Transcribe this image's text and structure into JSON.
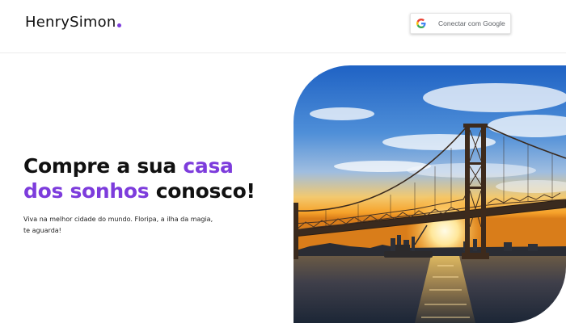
{
  "header": {
    "logo_text": "HenrySimon",
    "google_button_label": "Conectar com Google"
  },
  "hero": {
    "title_part1": "Compre a sua ",
    "title_accent1": "casa",
    "title_accent2": "dos sonhos",
    "title_part2": " conosco!",
    "subtitle_line1": "Viva na melhor cidade do mundo. Floripa, a ilha da magia,",
    "subtitle_line2": "te aguarda!"
  },
  "colors": {
    "accent": "#7d3cdc",
    "text": "#111111",
    "google_blue": "#4285F4",
    "google_red": "#EA4335",
    "google_yellow": "#FBBC05",
    "google_green": "#34A853"
  },
  "icons": {
    "google": "google-icon",
    "image": "bridge-sunset-photo"
  }
}
